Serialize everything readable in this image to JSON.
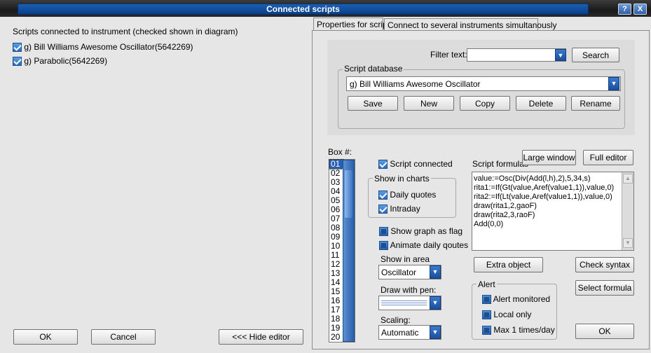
{
  "window": {
    "title": "Connected scripts",
    "help_btn": "?",
    "close_btn": "X"
  },
  "left": {
    "header": "Scripts connected to instrument (checked shown in diagram)",
    "scripts": [
      {
        "label": "g) Bill Williams Awesome Oscillator(5642269)",
        "checked": true
      },
      {
        "label": "g) Parabolic(5642269)",
        "checked": true
      }
    ],
    "ok_label": "OK",
    "cancel_label": "Cancel",
    "hide_editor_label": "<<< Hide editor"
  },
  "tabs": [
    {
      "label": "Properties for script",
      "active": true
    },
    {
      "label": "Connect to several instruments simultanously",
      "active": false
    }
  ],
  "filter": {
    "label": "Filter text:",
    "value": "",
    "search_label": "Search"
  },
  "database": {
    "legend": "Script database",
    "selected": "g) Bill Williams Awesome Oscillator",
    "buttons": [
      "Save",
      "New",
      "Copy",
      "Delete",
      "Rename"
    ]
  },
  "box": {
    "label": "Box #:",
    "items": [
      "01",
      "02",
      "03",
      "04",
      "05",
      "06",
      "07",
      "08",
      "09",
      "10",
      "11",
      "12",
      "13",
      "14",
      "15",
      "16",
      "17",
      "18",
      "19",
      "20"
    ],
    "selected": "01"
  },
  "options": {
    "script_connected": {
      "label": "Script connected",
      "checked": true
    },
    "show_in_charts": {
      "legend": "Show in charts",
      "daily": {
        "label": "Daily quotes",
        "checked": true
      },
      "intraday": {
        "label": "Intraday",
        "checked": true
      }
    },
    "show_graph_flag": {
      "label": "Show graph as flag",
      "checked": false
    },
    "animate": {
      "label": "Animate daily qoutes",
      "checked": false
    },
    "show_in_area": {
      "label": "Show in area",
      "value": "Oscillator"
    },
    "draw_with_pen": {
      "label": "Draw with pen:"
    },
    "scaling": {
      "label": "Scaling:",
      "value": "Automatic"
    }
  },
  "formulas": {
    "label": "Script formulas",
    "large_window": "Large window",
    "full_editor": "Full editor",
    "lines": [
      "value:=Osc(Div(Add(l,h),2),5,34,s)",
      "rita1:=If(Gt(value,Aref(value1,1)),value,0)",
      "rita2:=If(Lt(value,Aref(value1,1)),value,0)",
      "draw(rita1,2,gaoF)",
      "draw(rita2,3,raoF)",
      "Add(0,0)"
    ]
  },
  "actions": {
    "extra_object": "Extra object",
    "check_syntax": "Check syntax",
    "select_formula": "Select formula",
    "ok": "OK"
  },
  "alert": {
    "legend": "Alert",
    "monitored": {
      "label": "Alert monitored",
      "checked": false
    },
    "local_only": {
      "label": "Local only",
      "checked": false
    },
    "max_once": {
      "label": "Max 1 times/day",
      "checked": false
    }
  }
}
